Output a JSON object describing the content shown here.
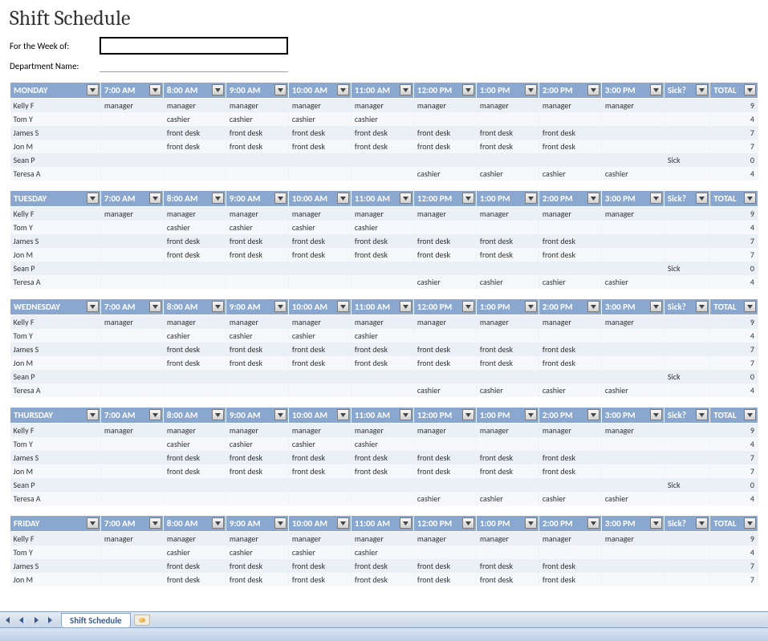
{
  "title": "Shift Schedule",
  "form": {
    "week_label": "For the Week of:",
    "dept_label": "Department Name:"
  },
  "columns": {
    "times": [
      "7:00 AM",
      "8:00 AM",
      "9:00 AM",
      "10:00 AM",
      "11:00 AM",
      "12:00 PM",
      "1:00 PM",
      "2:00 PM",
      "3:00 PM"
    ],
    "sick": "Sick?",
    "total": "TOTAL"
  },
  "days": [
    {
      "name": "MONDAY",
      "rows": [
        {
          "name": "Kelly F",
          "cells": [
            "manager",
            "manager",
            "manager",
            "manager",
            "manager",
            "manager",
            "manager",
            "manager",
            "manager"
          ],
          "sick": "",
          "total": "9"
        },
        {
          "name": "Tom Y",
          "cells": [
            "",
            "cashier",
            "cashier",
            "cashier",
            "cashier",
            "",
            "",
            "",
            ""
          ],
          "sick": "",
          "total": "4"
        },
        {
          "name": "James S",
          "cells": [
            "",
            "front desk",
            "front desk",
            "front desk",
            "front desk",
            "front desk",
            "front desk",
            "front desk",
            ""
          ],
          "sick": "",
          "total": "7"
        },
        {
          "name": "Jon M",
          "cells": [
            "",
            "front desk",
            "front desk",
            "front desk",
            "front desk",
            "front desk",
            "front desk",
            "front desk",
            ""
          ],
          "sick": "",
          "total": "7"
        },
        {
          "name": "Sean P",
          "cells": [
            "",
            "",
            "",
            "",
            "",
            "",
            "",
            "",
            ""
          ],
          "sick": "Sick",
          "total": "0"
        },
        {
          "name": "Teresa A",
          "cells": [
            "",
            "",
            "",
            "",
            "",
            "cashier",
            "cashier",
            "cashier",
            "cashier"
          ],
          "sick": "",
          "total": "4"
        }
      ]
    },
    {
      "name": "TUESDAY",
      "rows": [
        {
          "name": "Kelly F",
          "cells": [
            "manager",
            "manager",
            "manager",
            "manager",
            "manager",
            "manager",
            "manager",
            "manager",
            "manager"
          ],
          "sick": "",
          "total": "9"
        },
        {
          "name": "Tom Y",
          "cells": [
            "",
            "cashier",
            "cashier",
            "cashier",
            "cashier",
            "",
            "",
            "",
            ""
          ],
          "sick": "",
          "total": "4"
        },
        {
          "name": "James S",
          "cells": [
            "",
            "front desk",
            "front desk",
            "front desk",
            "front desk",
            "front desk",
            "front desk",
            "front desk",
            ""
          ],
          "sick": "",
          "total": "7"
        },
        {
          "name": "Jon M",
          "cells": [
            "",
            "front desk",
            "front desk",
            "front desk",
            "front desk",
            "front desk",
            "front desk",
            "front desk",
            ""
          ],
          "sick": "",
          "total": "7"
        },
        {
          "name": "Sean P",
          "cells": [
            "",
            "",
            "",
            "",
            "",
            "",
            "",
            "",
            ""
          ],
          "sick": "Sick",
          "total": "0"
        },
        {
          "name": "Teresa A",
          "cells": [
            "",
            "",
            "",
            "",
            "",
            "cashier",
            "cashier",
            "cashier",
            "cashier"
          ],
          "sick": "",
          "total": "4"
        }
      ]
    },
    {
      "name": "WEDNESDAY",
      "rows": [
        {
          "name": "Kelly F",
          "cells": [
            "manager",
            "manager",
            "manager",
            "manager",
            "manager",
            "manager",
            "manager",
            "manager",
            "manager"
          ],
          "sick": "",
          "total": "9"
        },
        {
          "name": "Tom Y",
          "cells": [
            "",
            "cashier",
            "cashier",
            "cashier",
            "cashier",
            "",
            "",
            "",
            ""
          ],
          "sick": "",
          "total": "4"
        },
        {
          "name": "James S",
          "cells": [
            "",
            "front desk",
            "front desk",
            "front desk",
            "front desk",
            "front desk",
            "front desk",
            "front desk",
            ""
          ],
          "sick": "",
          "total": "7"
        },
        {
          "name": "Jon M",
          "cells": [
            "",
            "front desk",
            "front desk",
            "front desk",
            "front desk",
            "front desk",
            "front desk",
            "front desk",
            ""
          ],
          "sick": "",
          "total": "7"
        },
        {
          "name": "Sean P",
          "cells": [
            "",
            "",
            "",
            "",
            "",
            "",
            "",
            "",
            ""
          ],
          "sick": "Sick",
          "total": "0"
        },
        {
          "name": "Teresa A",
          "cells": [
            "",
            "",
            "",
            "",
            "",
            "cashier",
            "cashier",
            "cashier",
            "cashier"
          ],
          "sick": "",
          "total": "4"
        }
      ]
    },
    {
      "name": "THURSDAY",
      "rows": [
        {
          "name": "Kelly F",
          "cells": [
            "manager",
            "manager",
            "manager",
            "manager",
            "manager",
            "manager",
            "manager",
            "manager",
            "manager"
          ],
          "sick": "",
          "total": "9"
        },
        {
          "name": "Tom Y",
          "cells": [
            "",
            "cashier",
            "cashier",
            "cashier",
            "cashier",
            "",
            "",
            "",
            ""
          ],
          "sick": "",
          "total": "4"
        },
        {
          "name": "James S",
          "cells": [
            "",
            "front desk",
            "front desk",
            "front desk",
            "front desk",
            "front desk",
            "front desk",
            "front desk",
            ""
          ],
          "sick": "",
          "total": "7"
        },
        {
          "name": "Jon M",
          "cells": [
            "",
            "front desk",
            "front desk",
            "front desk",
            "front desk",
            "front desk",
            "front desk",
            "front desk",
            ""
          ],
          "sick": "",
          "total": "7"
        },
        {
          "name": "Sean P",
          "cells": [
            "",
            "",
            "",
            "",
            "",
            "",
            "",
            "",
            ""
          ],
          "sick": "Sick",
          "total": "0"
        },
        {
          "name": "Teresa A",
          "cells": [
            "",
            "",
            "",
            "",
            "",
            "cashier",
            "cashier",
            "cashier",
            "cashier"
          ],
          "sick": "",
          "total": "4"
        }
      ]
    },
    {
      "name": "FRIDAY",
      "rows": [
        {
          "name": "Kelly F",
          "cells": [
            "manager",
            "manager",
            "manager",
            "manager",
            "manager",
            "manager",
            "manager",
            "manager",
            "manager"
          ],
          "sick": "",
          "total": "9"
        },
        {
          "name": "Tom Y",
          "cells": [
            "",
            "cashier",
            "cashier",
            "cashier",
            "cashier",
            "",
            "",
            "",
            ""
          ],
          "sick": "",
          "total": "4"
        },
        {
          "name": "James S",
          "cells": [
            "",
            "front desk",
            "front desk",
            "front desk",
            "front desk",
            "front desk",
            "front desk",
            "front desk",
            ""
          ],
          "sick": "",
          "total": "7"
        },
        {
          "name": "Jon M",
          "cells": [
            "",
            "front desk",
            "front desk",
            "front desk",
            "front desk",
            "front desk",
            "front desk",
            "front desk",
            ""
          ],
          "sick": "",
          "total": "7"
        }
      ]
    }
  ],
  "tabbar": {
    "tab_name": "Shift Schedule"
  }
}
